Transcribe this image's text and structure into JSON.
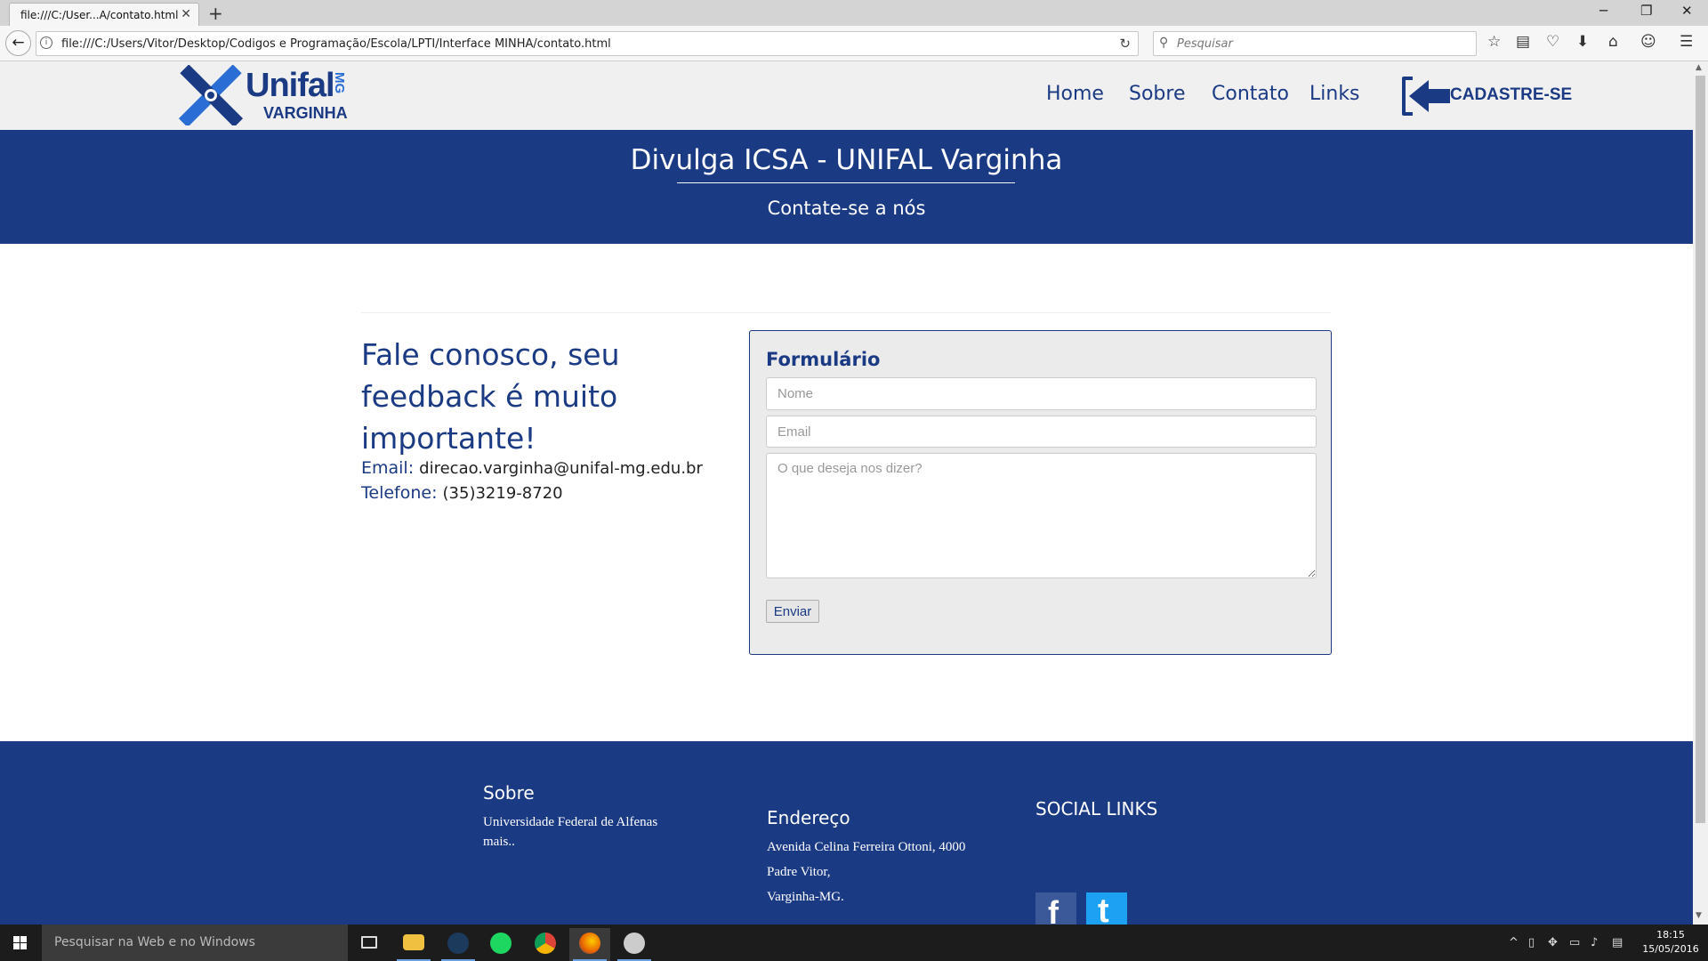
{
  "browser": {
    "tab_title": "file:///C:/User...A/contato.html",
    "url": "file:///C:/Users/Vitor/Desktop/Codigos e Programação/Escola/LPTI/Interface MINHA/contato.html",
    "search_placeholder": "Pesquisar",
    "icons": [
      "back-arrow",
      "info",
      "reload",
      "search",
      "star",
      "reading-list",
      "pocket",
      "download",
      "home",
      "chat",
      "menu"
    ]
  },
  "header": {
    "logo_word": "Unifal",
    "logo_sub": "VARGINHA",
    "logo_mg": "MG",
    "nav": [
      {
        "label": "Home"
      },
      {
        "label": "Sobre"
      },
      {
        "label": "Contato"
      },
      {
        "label": "Links"
      }
    ],
    "cadastre_label": "CADASTRE-SE"
  },
  "banner": {
    "title": "Divulga ICSA - UNIFAL Varginha",
    "subtitle": "Contate-se a nós"
  },
  "contact": {
    "lead": "Fale conosco, seu feedback é muito importante!",
    "email_label": "Email:",
    "email_value": "direcao.varginha@unifal-mg.edu.br",
    "phone_label": "Telefone:",
    "phone_value": "(35)3219-8720"
  },
  "form": {
    "title": "Formulário",
    "name_placeholder": "Nome",
    "email_placeholder": "Email",
    "message_placeholder": "O que deseja nos dizer?",
    "submit_label": "Enviar"
  },
  "footer": {
    "sobre_title": "Sobre",
    "sobre_text_1": "Universidade Federal de Alfenas",
    "sobre_text_2": "mais..",
    "endereco_title": "Endereço",
    "endereco_1": "Avenida Celina Ferreira Ottoni, 4000",
    "endereco_2": "Padre Vitor,",
    "endereco_3": "Varginha-MG.",
    "social_title": "SOCIAL LINKS",
    "facebook_glyph": "f",
    "twitter_glyph": "t",
    "colors": {
      "primary": "#1b3a84",
      "facebook": "#3b5998",
      "twitter": "#1da1f2"
    }
  },
  "taskbar": {
    "search_placeholder": "Pesquisar na Web e no Windows",
    "time": "18:15",
    "date": "15/05/2016",
    "apps": [
      "task-view",
      "file-explorer",
      "steam",
      "spotify",
      "chrome",
      "firefox",
      "paint"
    ]
  }
}
